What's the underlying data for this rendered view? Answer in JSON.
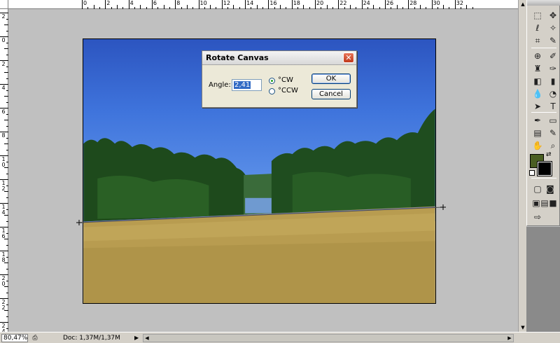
{
  "rulers": {
    "top_labels": [
      "0",
      "2",
      "4",
      "6",
      "8",
      "10",
      "12",
      "14",
      "16",
      "18",
      "20",
      "22",
      "24",
      "26",
      "28",
      "30",
      "32"
    ],
    "left_labels": [
      "2",
      "0",
      "2",
      "4",
      "6",
      "8",
      "1 0",
      "1 2",
      "1 4",
      "1 6",
      "1 8",
      "2 0",
      "2 2",
      "2 4"
    ]
  },
  "dialog": {
    "title": "Rotate Canvas",
    "close_glyph": "✕",
    "angle_label": "Angle:",
    "angle_value": "2,41",
    "options": [
      {
        "label": "°CW",
        "selected": true
      },
      {
        "label": "°CCW",
        "selected": false
      }
    ],
    "ok_label": "OK",
    "cancel_label": "Cancel"
  },
  "toolbox": {
    "tools": [
      {
        "icon": "marquee-icon",
        "glyph": "⬚"
      },
      {
        "icon": "move-icon",
        "glyph": "✥"
      },
      {
        "icon": "lasso-icon",
        "glyph": "ℓ"
      },
      {
        "icon": "magic-wand-icon",
        "glyph": "✧"
      },
      {
        "icon": "crop-icon",
        "glyph": "⌗"
      },
      {
        "icon": "slice-icon",
        "glyph": "✎"
      },
      {
        "icon": "healing-brush-icon",
        "glyph": "⊕"
      },
      {
        "icon": "brush-icon",
        "glyph": "✐"
      },
      {
        "icon": "clone-stamp-icon",
        "glyph": "♜"
      },
      {
        "icon": "history-brush-icon",
        "glyph": "✑"
      },
      {
        "icon": "eraser-icon",
        "glyph": "◧"
      },
      {
        "icon": "gradient-icon",
        "glyph": "▮"
      },
      {
        "icon": "blur-icon",
        "glyph": "💧"
      },
      {
        "icon": "dodge-icon",
        "glyph": "◔"
      },
      {
        "icon": "path-selection-icon",
        "glyph": "➤"
      },
      {
        "icon": "type-icon",
        "glyph": "T"
      },
      {
        "icon": "pen-icon",
        "glyph": "✒"
      },
      {
        "icon": "shape-icon",
        "glyph": "▭"
      },
      {
        "icon": "notes-icon",
        "glyph": "▤"
      },
      {
        "icon": "eyedropper-icon",
        "glyph": "✎"
      },
      {
        "icon": "hand-icon",
        "glyph": "✋"
      },
      {
        "icon": "zoom-icon",
        "glyph": "⌕"
      }
    ],
    "colors": {
      "foreground": "#4a5e22",
      "background": "#000000"
    },
    "modes": [
      {
        "icon": "standard-mode-icon",
        "glyph": "▢"
      },
      {
        "icon": "quick-mask-icon",
        "glyph": "◙"
      },
      {
        "icon": "screen-mode-standard-icon",
        "glyph": "▣"
      },
      {
        "icon": "screen-mode-menu-icon",
        "glyph": "▤"
      },
      {
        "icon": "screen-mode-full-icon",
        "glyph": "■"
      },
      {
        "icon": "imageready-icon",
        "glyph": "⇨"
      }
    ]
  },
  "status": {
    "zoom": "80,47%",
    "doc_info": "Doc: 1,37M/1,37M",
    "arrow_glyph": "▶"
  }
}
